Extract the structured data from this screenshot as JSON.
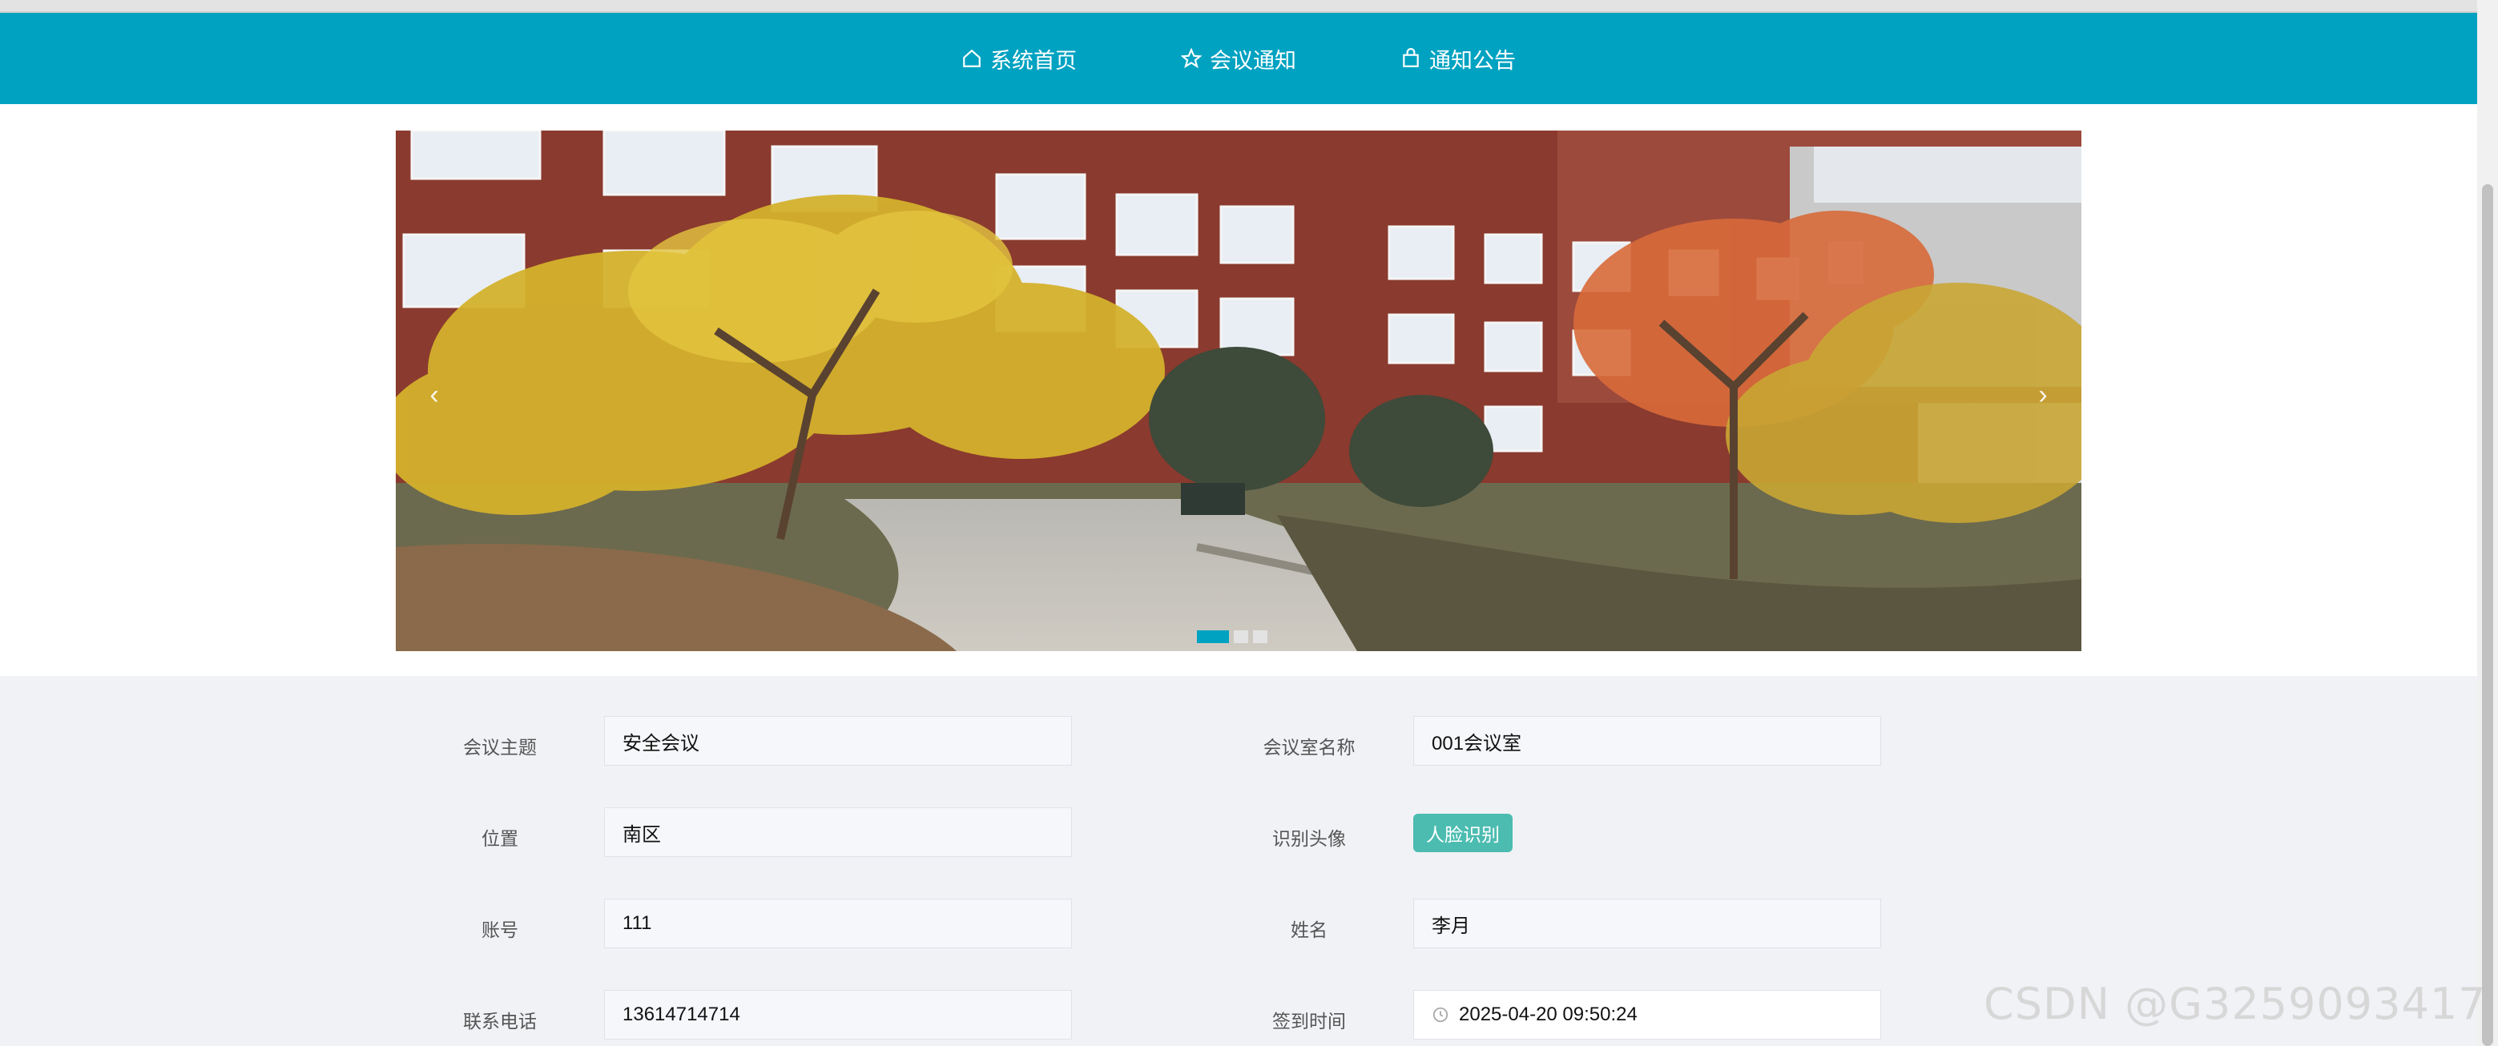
{
  "nav": {
    "items": [
      {
        "label": "系统首页",
        "icon": "home-icon"
      },
      {
        "label": "会议通知",
        "icon": "star-icon"
      },
      {
        "label": "通知公告",
        "icon": "bag-icon"
      }
    ]
  },
  "carousel": {
    "prev": "‹",
    "next": "›",
    "slide_count": 3,
    "active_slide": 1
  },
  "form": {
    "topic_label": "会议主题",
    "topic_value": "安全会议",
    "room_label": "会议室名称",
    "room_value": "001会议室",
    "location_label": "位置",
    "location_value": "南区",
    "avatar_label": "识别头像",
    "face_button": "人脸识别",
    "account_label": "账号",
    "account_value": "111",
    "name_label": "姓名",
    "name_value": "李月",
    "phone_label": "联系电话",
    "phone_value": "13614714714",
    "signin_label": "签到时间",
    "signin_value": "2025-04-20 09:50:24"
  },
  "watermark": "CSDN @G3259093417",
  "colors": {
    "accent": "#00a2c1",
    "face_button": "#4cbcb1"
  }
}
